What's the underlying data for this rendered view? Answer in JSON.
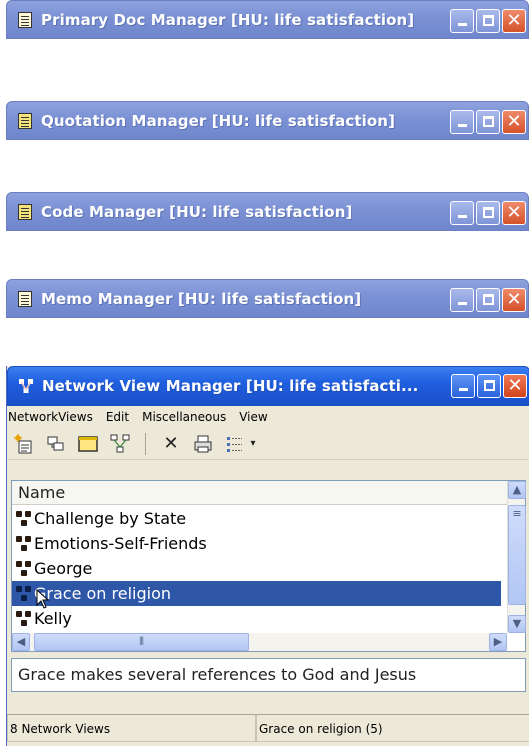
{
  "windows": [
    {
      "title": "Primary Doc Manager [HU: life satisfaction]",
      "icon": "document-icon",
      "color": "#7b91d4"
    },
    {
      "title": "Quotation Manager [HU: life satisfaction]",
      "icon": "quote-doc-icon",
      "color": "#7b91d4"
    },
    {
      "title": "Code Manager [HU: life satisfaction]",
      "icon": "code-doc-icon",
      "color": "#7b91d4"
    },
    {
      "title": "Memo Manager [HU: life satisfaction]",
      "icon": "memo-doc-icon",
      "color": "#7b91d4"
    }
  ],
  "network": {
    "title": "Network View Manager [HU: life satisfacti...",
    "menu": [
      "NetworkViews",
      "Edit",
      "Miscellaneous",
      "View"
    ],
    "toolbar_icons": [
      "new-network-icon",
      "open-network-icon",
      "window-icon",
      "network-layout-icon",
      "delete-icon",
      "print-icon",
      "list-view-icon",
      "dropdown-arrow-icon"
    ],
    "list_header": "Name",
    "items": [
      "Challenge by State",
      "Emotions-Self-Friends",
      "George",
      "Grace on religion",
      "Kelly"
    ],
    "selected": "Grace on religion",
    "memo": "Grace makes several references to God and Jesus",
    "status_left": "8 Network Views",
    "status_right": "Grace on religion (5)",
    "accent": "#2f57a8"
  }
}
